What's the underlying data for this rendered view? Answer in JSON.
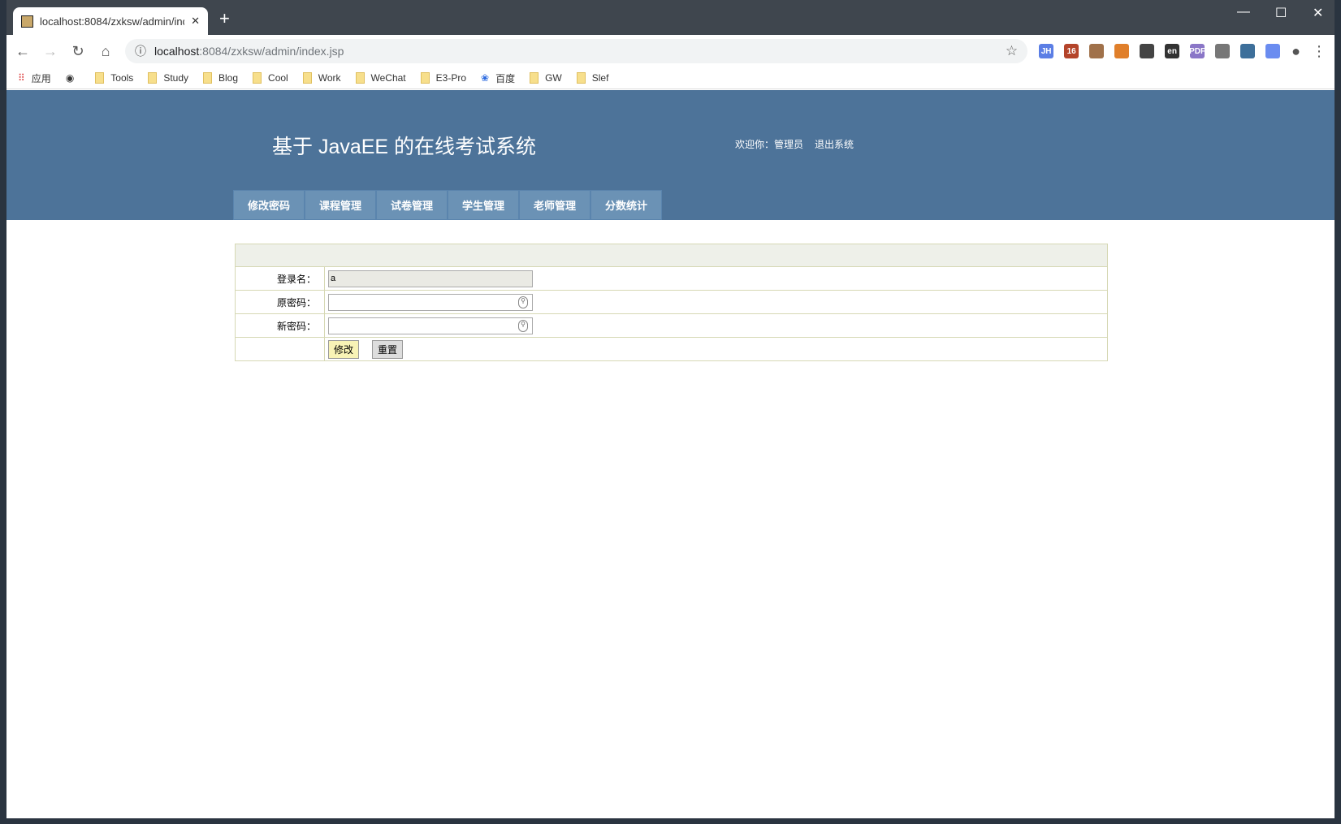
{
  "browser": {
    "tab_title": "localhost:8084/zxksw/admin/index.jsp",
    "new_tab": "+",
    "url_host": "localhost",
    "url_rest": ":8084/zxksw/admin/index.jsp",
    "extensions": [
      {
        "name": "JH",
        "color": "#5b7ee5"
      },
      {
        "name": "16",
        "color": "#b4442a"
      },
      {
        "name": "",
        "color": "#a0714a"
      },
      {
        "name": "",
        "color": "#e07f2a"
      },
      {
        "name": "",
        "color": "#444444"
      },
      {
        "name": "en",
        "color": "#333333"
      },
      {
        "name": "PDF",
        "color": "#8a76c7"
      },
      {
        "name": "",
        "color": "#777777"
      },
      {
        "name": "",
        "color": "#3d6f9a"
      },
      {
        "name": "",
        "color": "#6a8cf0"
      }
    ],
    "bookmarks": [
      "应用",
      "",
      "Tools",
      "Study",
      "Blog",
      "Cool",
      "Work",
      "WeChat",
      "E3-Pro",
      "百度",
      "GW",
      "Slef"
    ]
  },
  "header": {
    "title": "基于 JavaEE 的在线考试系统",
    "welcome": "欢迎你：管理员",
    "logout": "退出系统"
  },
  "nav": [
    "修改密码",
    "课程管理",
    "试卷管理",
    "学生管理",
    "老师管理",
    "分数统计"
  ],
  "form": {
    "username_label": "登录名：",
    "username_value": "a",
    "old_label": "原密码：",
    "new_label": "新密码：",
    "submit": "修改",
    "reset": "重置"
  },
  "colors": {
    "header": "#4d7399",
    "nav": "#6b92b5"
  }
}
